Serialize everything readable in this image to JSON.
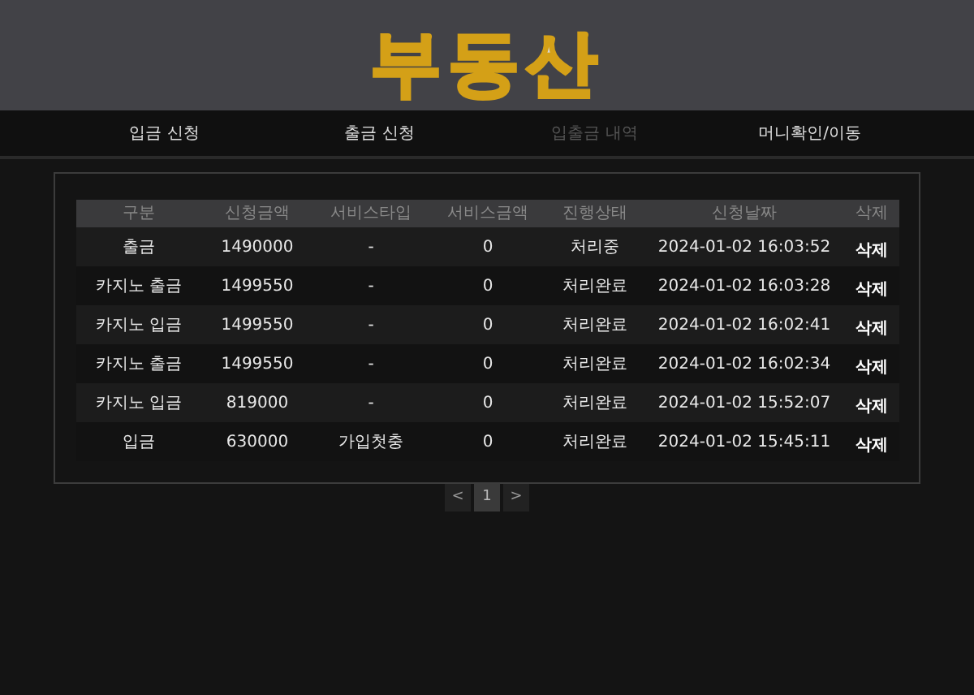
{
  "logo": "부동산",
  "nav": [
    {
      "label": "입금 신청",
      "selected": false
    },
    {
      "label": "출금 신청",
      "selected": false
    },
    {
      "label": "입출금 내역",
      "selected": true
    },
    {
      "label": "머니확인/이동",
      "selected": false
    }
  ],
  "table": {
    "columns": [
      "구분",
      "신청금액",
      "서비스타입",
      "서비스금액",
      "진행상태",
      "신청날짜",
      "삭제"
    ],
    "rows": [
      [
        "출금",
        "1490000",
        "-",
        "0",
        "처리중",
        "2024-01-02 16:03:52",
        "삭제"
      ],
      [
        "카지노 출금",
        "1499550",
        "-",
        "0",
        "처리완료",
        "2024-01-02 16:03:28",
        "삭제"
      ],
      [
        "카지노 입금",
        "1499550",
        "-",
        "0",
        "처리완료",
        "2024-01-02 16:02:41",
        "삭제"
      ],
      [
        "카지노 출금",
        "1499550",
        "-",
        "0",
        "처리완료",
        "2024-01-02 16:02:34",
        "삭제"
      ],
      [
        "카지노 입금",
        "819000",
        "-",
        "0",
        "처리완료",
        "2024-01-02 15:52:07",
        "삭제"
      ],
      [
        "입금",
        "630000",
        "가입첫충",
        "0",
        "처리완료",
        "2024-01-02 15:45:11",
        "삭제"
      ]
    ]
  },
  "pagination": [
    {
      "label": "<",
      "selected": false
    },
    {
      "label": "1",
      "selected": true
    },
    {
      "label": ">",
      "selected": false
    }
  ]
}
